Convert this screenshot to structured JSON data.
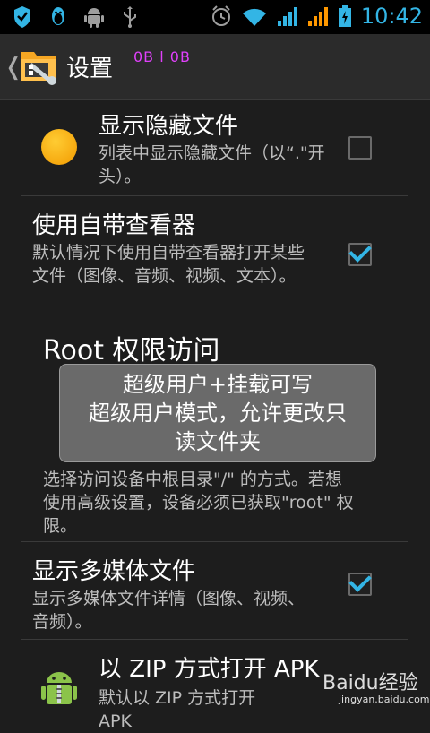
{
  "status_bar": {
    "time": "10:42",
    "icons_left": [
      "shield-icon",
      "qq-penguin-icon",
      "android-icon",
      "usb-icon"
    ],
    "icons_right": [
      "alarm-icon",
      "wifi-icon",
      "signal-icon",
      "signal-icon",
      "battery-icon"
    ]
  },
  "action_bar": {
    "back_glyph": "《",
    "title": "设置",
    "tag": "0B l 0B"
  },
  "prefs": [
    {
      "title": "显示隐藏文件",
      "summary": "列表中显示隐藏文件（以“.\"开头）。",
      "checked": false,
      "icon": "orange-circle-icon"
    },
    {
      "title": "使用自带查看器",
      "summary": "默认情况下使用自带查看器打开某些文件（图像、音频、视频、文本）。",
      "checked": true
    },
    {
      "title": "Root 权限访问",
      "summary": "选择访问设备中根目录\"/\" 的方式。若想使用高级设置，设备必须已获取\"root\" 权限。"
    },
    {
      "title": "显示多媒体文件",
      "summary": "显示多媒体文件详情（图像、视频、音频）。",
      "checked": true
    },
    {
      "title": "以 ZIP 方式打开 APK",
      "summary": "默认以 ZIP 方式打开 APK",
      "icon": "android-zip-icon"
    }
  ],
  "toast": {
    "line1": "超级用户+挂载可写",
    "line2": "超级用户模式，允许更改只",
    "line3": "读文件夹"
  },
  "watermark": {
    "brand": "Baidu经验",
    "url": "jingyan.baidu.com"
  },
  "colors": {
    "accent": "#33b5e5",
    "tag": "#e040fb",
    "toast_bg": "#6a6a6a"
  }
}
